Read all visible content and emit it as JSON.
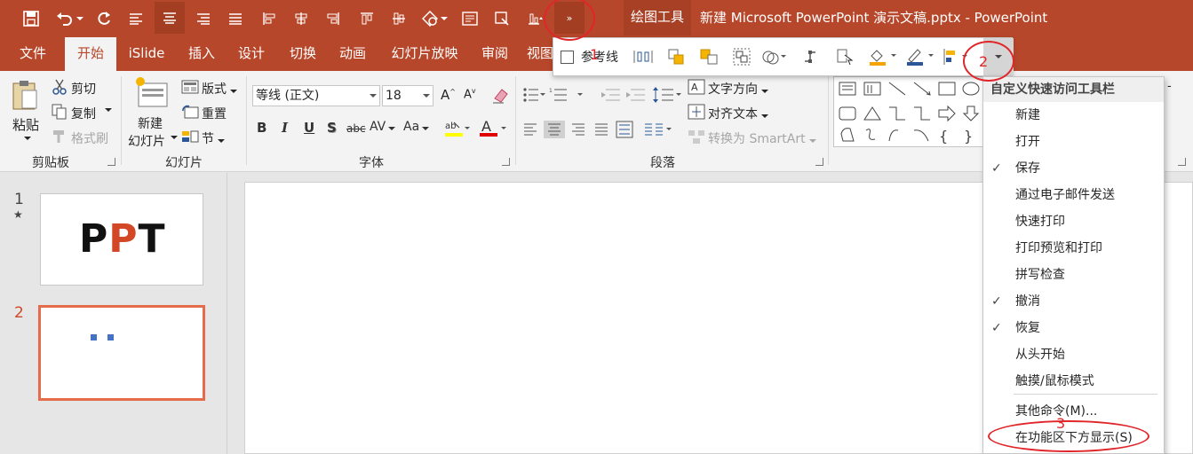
{
  "titlebar": {
    "context_tab": "绘图工具",
    "doc_title": "新建 Microsoft PowerPoint 演示文稿.pptx  -  PowerPoint",
    "qat_icons": [
      "save-icon",
      "undo-icon",
      "redo-icon",
      "align-left-icon",
      "align-center-icon",
      "align-right-icon",
      "justify-icon",
      "align-objects-left-icon",
      "align-objects-center-icon",
      "align-objects-right-icon",
      "align-objects-top-icon",
      "align-objects-middle-icon",
      "shape-icon",
      "textbox-icon",
      "crop-icon",
      "align-bottom-icon",
      "more-commands-icon"
    ]
  },
  "tabs": [
    "文件",
    "开始",
    "iSlide",
    "插入",
    "设计",
    "切换",
    "动画",
    "幻灯片放映",
    "审阅",
    "视图"
  ],
  "ribbon": {
    "clipboard": {
      "paste": "粘贴",
      "cut": "剪切",
      "copy": "复制",
      "format_painter": "格式刷",
      "label": "剪贴板"
    },
    "slides": {
      "new_slide_1": "新建",
      "new_slide_2": "幻灯片",
      "layout": "版式",
      "reset": "重置",
      "section": "节",
      "label": "幻灯片"
    },
    "font": {
      "font_name": "等线 (正文)",
      "font_size": "18",
      "bold": "B",
      "italic": "I",
      "underline": "U",
      "shadow": "S",
      "strike": "abc",
      "spacing": "AV",
      "case": "Aa",
      "label": "字体"
    },
    "paragraph": {
      "text_direction": "文字方向",
      "align_text": "对齐文本",
      "smartart": "转换为 SmartArt",
      "label": "段落"
    }
  },
  "floating_toolbar": {
    "guides_label": "参考线"
  },
  "menu": {
    "header": "自定义快速访问工具栏",
    "items": [
      {
        "label": "新建",
        "checked": false
      },
      {
        "label": "打开",
        "checked": false
      },
      {
        "label": "保存",
        "checked": true
      },
      {
        "label": "通过电子邮件发送",
        "checked": false
      },
      {
        "label": "快速打印",
        "checked": false
      },
      {
        "label": "打印预览和打印",
        "checked": false
      },
      {
        "label": "拼写检查",
        "checked": false
      },
      {
        "label": "撤消",
        "checked": true
      },
      {
        "label": "恢复",
        "checked": true
      },
      {
        "label": "从头开始",
        "checked": false
      },
      {
        "label": "触摸/鼠标模式",
        "checked": false
      }
    ],
    "more": "其他命令(M)...",
    "show_below": "在功能区下方显示(S)",
    "check_glyph": "✓"
  },
  "slides": [
    {
      "number": "1",
      "star": "★",
      "title_p1": "P",
      "title_p2": "P",
      "title_t": "T"
    },
    {
      "number": "2"
    }
  ],
  "annotations": [
    "1",
    "2",
    "3"
  ],
  "colors": {
    "accent": "#b7472a",
    "annotation": "#e0262a",
    "thumb_selected": "#e46c4b"
  }
}
